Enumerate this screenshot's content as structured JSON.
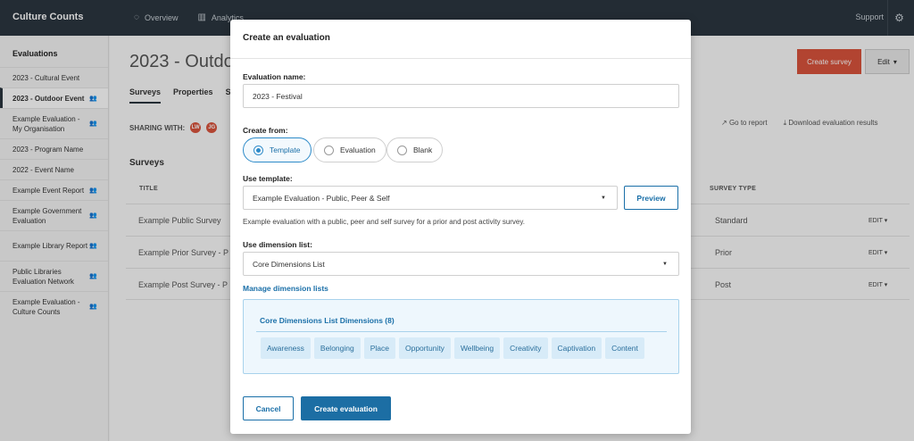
{
  "topbar": {
    "brand": "Culture Counts",
    "nav": [
      {
        "label": "Overview",
        "icon": "spinner-icon"
      },
      {
        "label": "Analytics",
        "icon": "bar-chart-icon"
      }
    ],
    "support": "Support"
  },
  "sidebar": {
    "heading": "Evaluations",
    "items": [
      {
        "label": "2023 - Cultural Event",
        "shared": false,
        "active": false
      },
      {
        "label": "2023 - Outdoor Event",
        "shared": true,
        "active": true
      },
      {
        "label": "Example Evaluation - My Organisation",
        "shared": true,
        "active": false
      },
      {
        "label": "2023 - Program Name",
        "shared": false,
        "active": false
      },
      {
        "label": "2022 - Event Name",
        "shared": false,
        "active": false
      },
      {
        "label": "Example Event Report",
        "shared": true,
        "active": false
      },
      {
        "label": "Example Government Evaluation",
        "shared": true,
        "active": false
      },
      {
        "label": "Example Library Report",
        "shared": true,
        "active": false
      },
      {
        "label": "Public Libraries Evaluation Network",
        "shared": true,
        "active": false
      },
      {
        "label": "Example Evaluation - Culture Counts",
        "shared": true,
        "active": false
      }
    ]
  },
  "main": {
    "title": "2023 - Outdo",
    "tabs": [
      "Surveys",
      "Properties",
      "Sh"
    ],
    "create_survey": "Create survey",
    "edit": "Edit",
    "sharing_label": "SHARING WITH:",
    "avatars": [
      "LW",
      "JG"
    ],
    "go_to_report": "Go to report",
    "download_results": "Download evaluation results",
    "surveys_title": "Surveys",
    "columns": {
      "title": "TITLE",
      "type": "SURVEY TYPE"
    },
    "rows": [
      {
        "title": "Example Public Survey",
        "type": "Standard",
        "action": "EDIT"
      },
      {
        "title": "Example Prior Survey - P",
        "type": "Prior",
        "action": "EDIT"
      },
      {
        "title": "Example Post Survey - P",
        "type": "Post",
        "action": "EDIT"
      }
    ]
  },
  "modal": {
    "title": "Create an evaluation",
    "name_label": "Evaluation name:",
    "name_value": "2023 - Festival",
    "create_from_label": "Create from:",
    "create_from_options": [
      "Template",
      "Evaluation",
      "Blank"
    ],
    "template_label": "Use template:",
    "template_value": "Example Evaluation - Public, Peer & Self",
    "preview": "Preview",
    "template_description": "Example evaluation with a public, peer and self survey for a prior and post activity survey.",
    "dimension_label": "Use dimension list:",
    "dimension_value": "Core Dimensions List",
    "manage_link": "Manage dimension lists",
    "dimensions_title": "Core Dimensions List Dimensions (8)",
    "dimensions": [
      "Awareness",
      "Belonging",
      "Place",
      "Opportunity",
      "Wellbeing",
      "Creativity",
      "Captivation",
      "Content"
    ],
    "cancel": "Cancel",
    "submit": "Create evaluation"
  },
  "colors": {
    "topbar": "#2b3640",
    "accent": "#1c6ea4",
    "create_survey": "#d9533c"
  }
}
